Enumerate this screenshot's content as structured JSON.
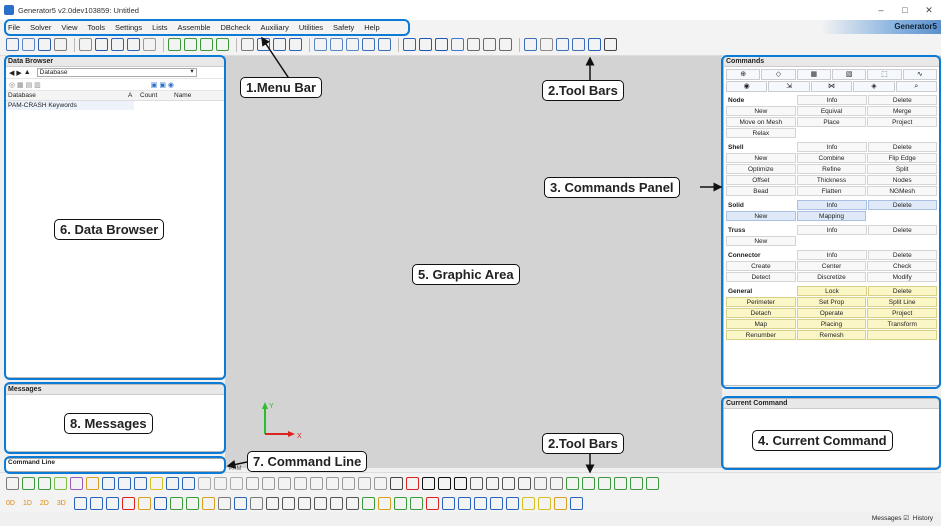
{
  "window": {
    "title": "Generator5 v2.0dev103859: Untitled",
    "min": "–",
    "max": "□",
    "close": "✕"
  },
  "menu": [
    "File",
    "Solver",
    "View",
    "Tools",
    "Settings",
    "Lists",
    "Assemble",
    "DBcheck",
    "Auxiliary",
    "Utilities",
    "Safety",
    "Help"
  ],
  "brand": "Generator5",
  "data_browser": {
    "title": "Data Browser",
    "dropdown": "Database",
    "columns": [
      "Database",
      "A",
      "Count",
      "Name"
    ],
    "items": [
      "PAM-CRASH Keywords"
    ]
  },
  "messages": {
    "title": "Messages"
  },
  "command_line": {
    "title": "Command Line"
  },
  "commands": {
    "title": "Commands",
    "sections": [
      {
        "name": "Node",
        "rows": [
          [
            "",
            "Info",
            "Delete"
          ],
          [
            "New",
            "Equival",
            "Merge"
          ],
          [
            "Move on Mesh",
            "Place",
            "Project"
          ],
          [
            "Relax",
            "",
            ""
          ]
        ]
      },
      {
        "name": "Shell",
        "rows": [
          [
            "",
            "Info",
            "Delete"
          ],
          [
            "New",
            "Combine",
            "Flip Edge"
          ],
          [
            "Optimize",
            "Refine",
            "Split"
          ],
          [
            "Offset",
            "Thickness",
            "Nodes"
          ],
          [
            "Bead",
            "Flatten",
            "NGMesh"
          ]
        ]
      },
      {
        "name": "Solid",
        "rows": [
          [
            "",
            "Info",
            "Delete"
          ],
          [
            "New",
            "Mapping",
            ""
          ]
        ]
      },
      {
        "name": "Truss",
        "rows": [
          [
            "",
            "Info",
            "Delete"
          ],
          [
            "New",
            "",
            ""
          ]
        ]
      },
      {
        "name": "Connector",
        "rows": [
          [
            "",
            "Info",
            "Delete"
          ],
          [
            "Create",
            "Center",
            "Check"
          ],
          [
            "Detect",
            "Discretize",
            "Modify"
          ]
        ]
      },
      {
        "name": "General",
        "rows": [
          [
            "",
            "Lock",
            "Delete"
          ],
          [
            "Perimeter",
            "Set Prop",
            "Split Line"
          ],
          [
            "Detach",
            "Operate",
            "Project"
          ],
          [
            "Map",
            "Placing",
            "Transform"
          ],
          [
            "Renumber",
            "Remesh",
            ""
          ]
        ]
      }
    ]
  },
  "current_command": {
    "title": "Current Command"
  },
  "bottom_toolbar": {
    "row2_labels": [
      "0D",
      "1D",
      "2D",
      "3D"
    ]
  },
  "status": {
    "messages": "Messages ☑",
    "history": "History"
  },
  "axis": {
    "x": "X",
    "y": "Y"
  },
  "pam_label": "PAM",
  "annotations": {
    "menu_bar": "1.Menu Bar",
    "tool_bars_top": "2.Tool Bars",
    "tool_bars_bottom": "2.Tool Bars",
    "commands_panel": "3. Commands Panel",
    "current_command": "4. Current Command",
    "graphic_area": "5. Graphic Area",
    "data_browser": "6. Data Browser",
    "command_line": "7. Command Line",
    "messages": "8. Messages"
  }
}
